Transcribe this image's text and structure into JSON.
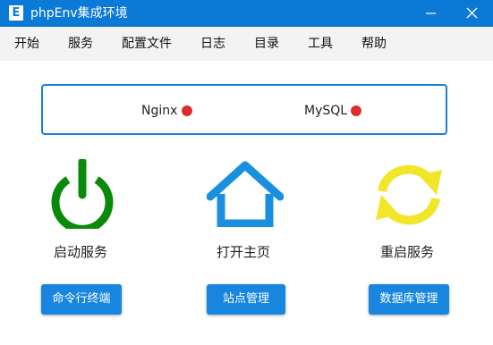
{
  "window": {
    "app_icon_letter": "E",
    "title": "phpEnv集成环境"
  },
  "menu": {
    "items": [
      "开始",
      "服务",
      "配置文件",
      "日志",
      "目录",
      "工具",
      "帮助"
    ]
  },
  "status": {
    "services": [
      {
        "name": "Nginx",
        "state_color": "#e02b2b"
      },
      {
        "name": "MySQL",
        "state_color": "#e02b2b"
      }
    ]
  },
  "actions": {
    "start_label": "启动服务",
    "home_label": "打开主页",
    "restart_label": "重启服务"
  },
  "buttons": {
    "terminal": "命令行终端",
    "sites": "站点管理",
    "database": "数据库管理"
  },
  "colors": {
    "titlebar": "#0a7ad6",
    "power_icon": "#0a8a0a",
    "home_icon": "#1a8fe0",
    "restart_icon": "#f2e62a",
    "button": "#1886de",
    "status_off": "#e02b2b"
  }
}
